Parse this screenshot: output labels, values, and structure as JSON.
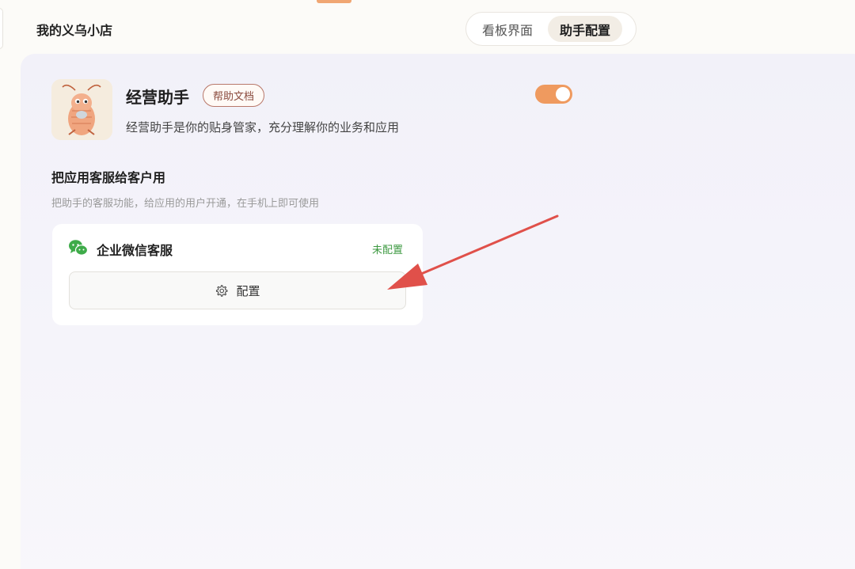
{
  "header": {
    "shop_name": "我的义乌小店",
    "tabs": [
      {
        "label": "看板界面",
        "active": false
      },
      {
        "label": "助手配置",
        "active": true
      }
    ]
  },
  "assistant": {
    "avatar_icon": "shrimp-mascot",
    "title": "经营助手",
    "help_label": "帮助文档",
    "description": "经营助手是你的贴身管家，充分理解你的业务和应用",
    "enabled": true
  },
  "section": {
    "title": "把应用客服给客户用",
    "subtitle": "把助手的客服功能，给应用的用户开通，在手机上即可使用"
  },
  "channel": {
    "icon": "wechat-icon",
    "title": "企业微信客服",
    "status": "未配置",
    "button_label": "配置",
    "button_icon": "gear-icon"
  },
  "colors": {
    "accent": "#ef9a5f",
    "status_green": "#3e9a42",
    "annotation_arrow": "#e0504a",
    "help_border": "#b8786a"
  }
}
